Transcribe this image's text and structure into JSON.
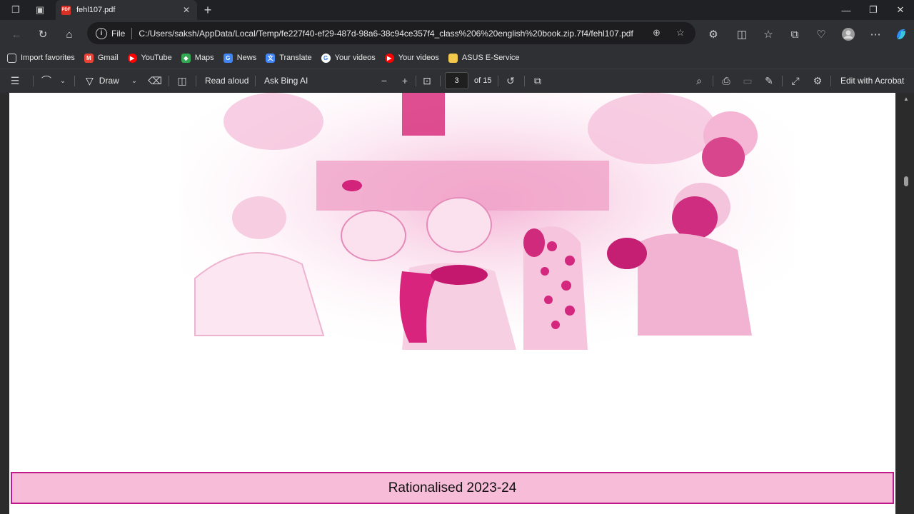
{
  "tab": {
    "title": "fehl107.pdf",
    "badge": "PDF"
  },
  "address": {
    "scheme": "File",
    "url": "C:/Users/saksh/AppData/Local/Temp/fe227f40-ef29-487d-98a6-38c94ce357f4_class%206%20english%20book.zip.7f4/fehl107.pdf"
  },
  "favorites": [
    {
      "label": "Import favorites",
      "icon": "import-icon",
      "color": "#cfcfcf"
    },
    {
      "label": "Gmail",
      "icon": "gmail-icon",
      "color": "#ea4335"
    },
    {
      "label": "YouTube",
      "icon": "youtube-icon",
      "color": "#ff0000"
    },
    {
      "label": "Maps",
      "icon": "maps-icon",
      "color": "#34a853"
    },
    {
      "label": "News",
      "icon": "news-icon",
      "color": "#4285f4"
    },
    {
      "label": "Translate",
      "icon": "translate-icon",
      "color": "#4285f4"
    },
    {
      "label": "Your videos",
      "icon": "google-icon",
      "color": "#ffffff"
    },
    {
      "label": "Your videos",
      "icon": "youtube-icon",
      "color": "#ff0000"
    },
    {
      "label": "ASUS E-Service",
      "icon": "folder-icon",
      "color": "#f2c94c"
    }
  ],
  "pdf_toolbar": {
    "draw_label": "Draw",
    "read_aloud_label": "Read aloud",
    "ask_bing_label": "Ask Bing AI",
    "page_number": "3",
    "page_total": "of 15",
    "edit_acrobat_label": "Edit with Acrobat"
  },
  "document": {
    "footer_text": "Rationalised 2023-24"
  },
  "colors": {
    "accent_pink": "#c0198c",
    "footer_fill": "#f6bcd8"
  }
}
